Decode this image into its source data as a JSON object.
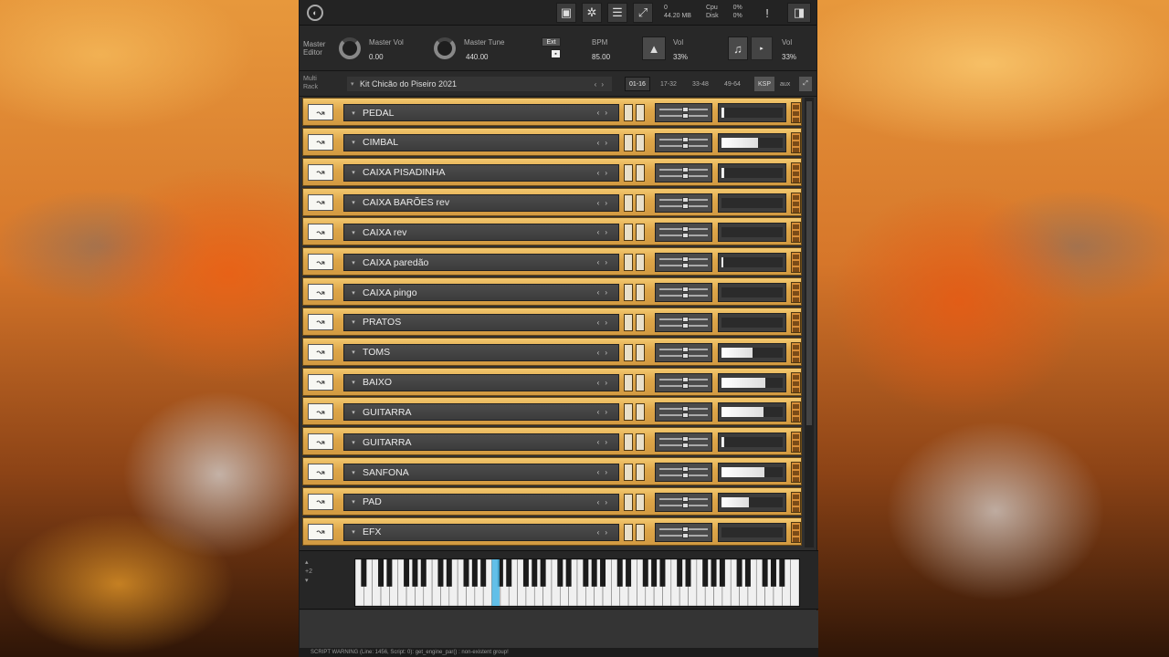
{
  "header": {
    "logo_icon": "kontakt-logo",
    "memory": {
      "voices": "0",
      "mem": "44.20 MB",
      "cpu_label": "Cpu",
      "cpu": "0%",
      "disk_label": "Disk",
      "disk": "0%"
    }
  },
  "master": {
    "editor_label_1": "Master",
    "editor_label_2": "Editor",
    "vol_label": "Master Vol",
    "vol_value": "0.00",
    "tune_label": "Master Tune",
    "tune_value": "440.00",
    "ext_label": "Ext",
    "bpm_label": "BPM",
    "bpm_value": "85.00",
    "metro_vol_label": "Vol",
    "metro_vol_value": "33%",
    "ref_vol_label": "Vol",
    "ref_vol_value": "33%"
  },
  "rack": {
    "label_1": "Multi",
    "label_2": "Rack",
    "preset": "Kit Chicão do Piseiro 2021",
    "pages": [
      "01-16",
      "17-32",
      "33-48",
      "49-64",
      "KSP",
      "aux"
    ],
    "active_page": "01-16"
  },
  "instruments": [
    {
      "name": "PEDAL",
      "level": 0.05
    },
    {
      "name": "CIMBAL",
      "level": 0.6
    },
    {
      "name": "CAIXA PISADINHA",
      "level": 0.05
    },
    {
      "name": "CAIXA BARÕES rev",
      "level": 0.0
    },
    {
      "name": "CAIXA rev",
      "level": 0.0
    },
    {
      "name": "CAIXA paredão",
      "level": 0.03
    },
    {
      "name": "CAIXA pingo",
      "level": 0.0
    },
    {
      "name": "PRATOS",
      "level": 0.0
    },
    {
      "name": "TOMS",
      "level": 0.5
    },
    {
      "name": "BAIXO",
      "level": 0.72
    },
    {
      "name": "GUITARRA",
      "level": 0.68
    },
    {
      "name": "GUITARRA",
      "level": 0.04
    },
    {
      "name": "SANFONA",
      "level": 0.7
    },
    {
      "name": "PAD",
      "level": 0.45
    },
    {
      "name": "EFX",
      "level": 0.0
    }
  ],
  "keyboard": {
    "octave_label": "+2",
    "highlight": "#49b6e6"
  },
  "status": {
    "text": "SCRIPT WARNING (Line: 1456, Script: 0):  get_engine_par() : non-existent group!"
  },
  "colors": {
    "panel_gold": "#e0ab52",
    "vu_fill": "#ffffff"
  }
}
